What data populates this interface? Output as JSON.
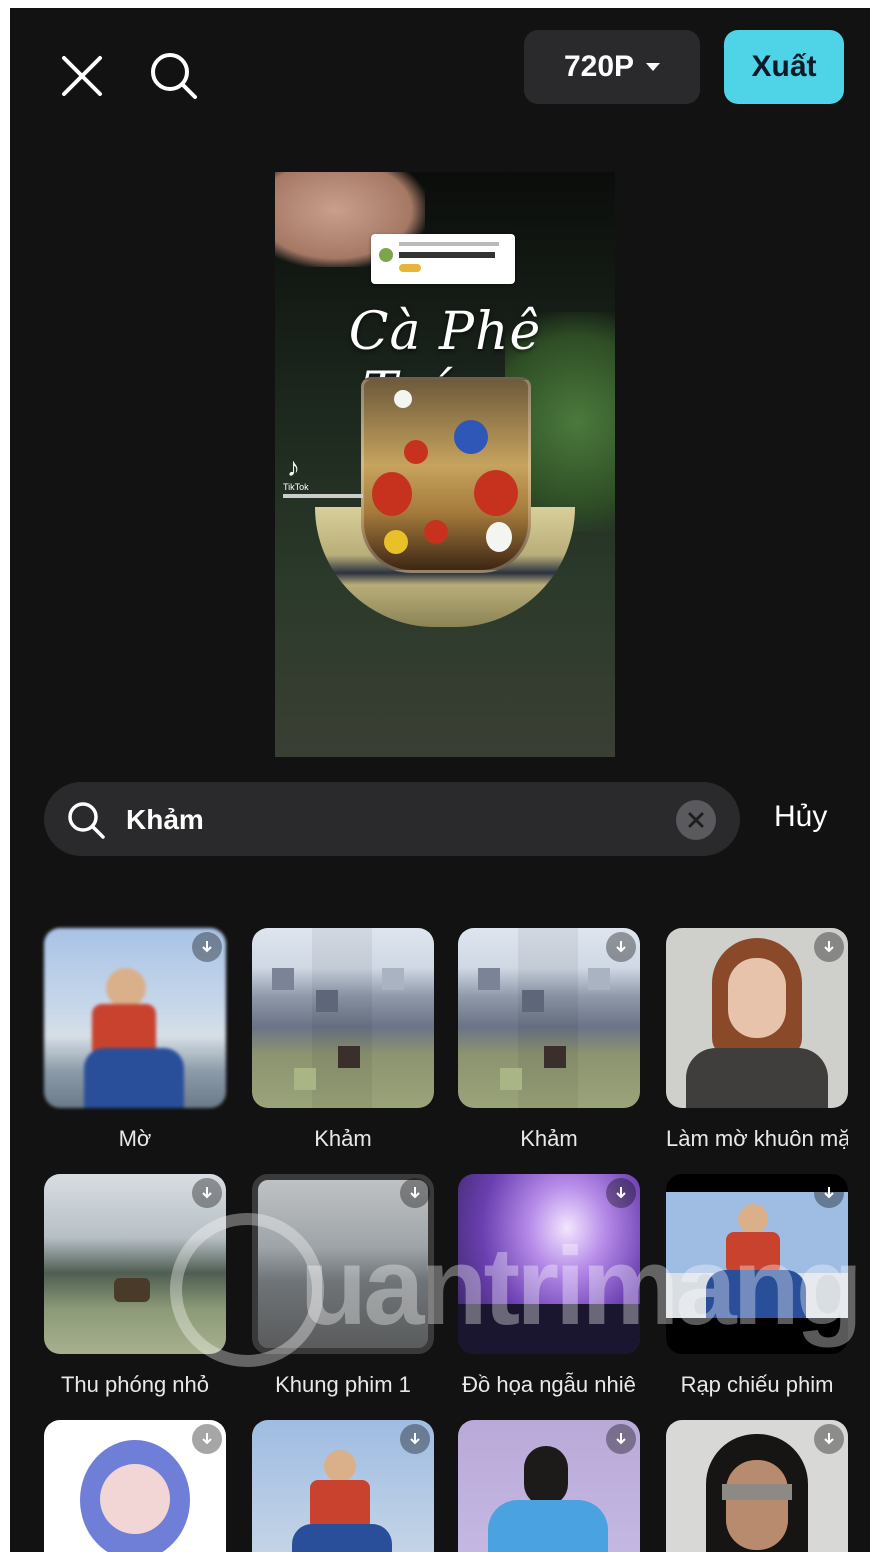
{
  "toolbar": {
    "close_icon": "close-icon",
    "search_icon": "search-icon",
    "resolution_label": "720P",
    "export_label": "Xuất"
  },
  "preview": {
    "title_overlay": "Cà Phê Trứng",
    "platform_label": "TikTok"
  },
  "search": {
    "query": "Khảm",
    "cancel_label": "Hủy"
  },
  "effects": [
    {
      "label": "Mờ"
    },
    {
      "label": "Khảm"
    },
    {
      "label": "Khảm"
    },
    {
      "label": "Làm mờ khuôn mặ"
    },
    {
      "label": "Thu phóng nhỏ"
    },
    {
      "label": "Khung phim 1"
    },
    {
      "label": "Đồ họa ngẫu nhiê"
    },
    {
      "label": "Rạp chiếu phim"
    },
    {
      "label": ""
    },
    {
      "label": ""
    },
    {
      "label": ""
    },
    {
      "label": ""
    }
  ],
  "watermark": {
    "text": "uantrimang"
  },
  "colors": {
    "accent": "#4fd3e6",
    "background": "#121212",
    "surface": "#2a2a2c"
  }
}
